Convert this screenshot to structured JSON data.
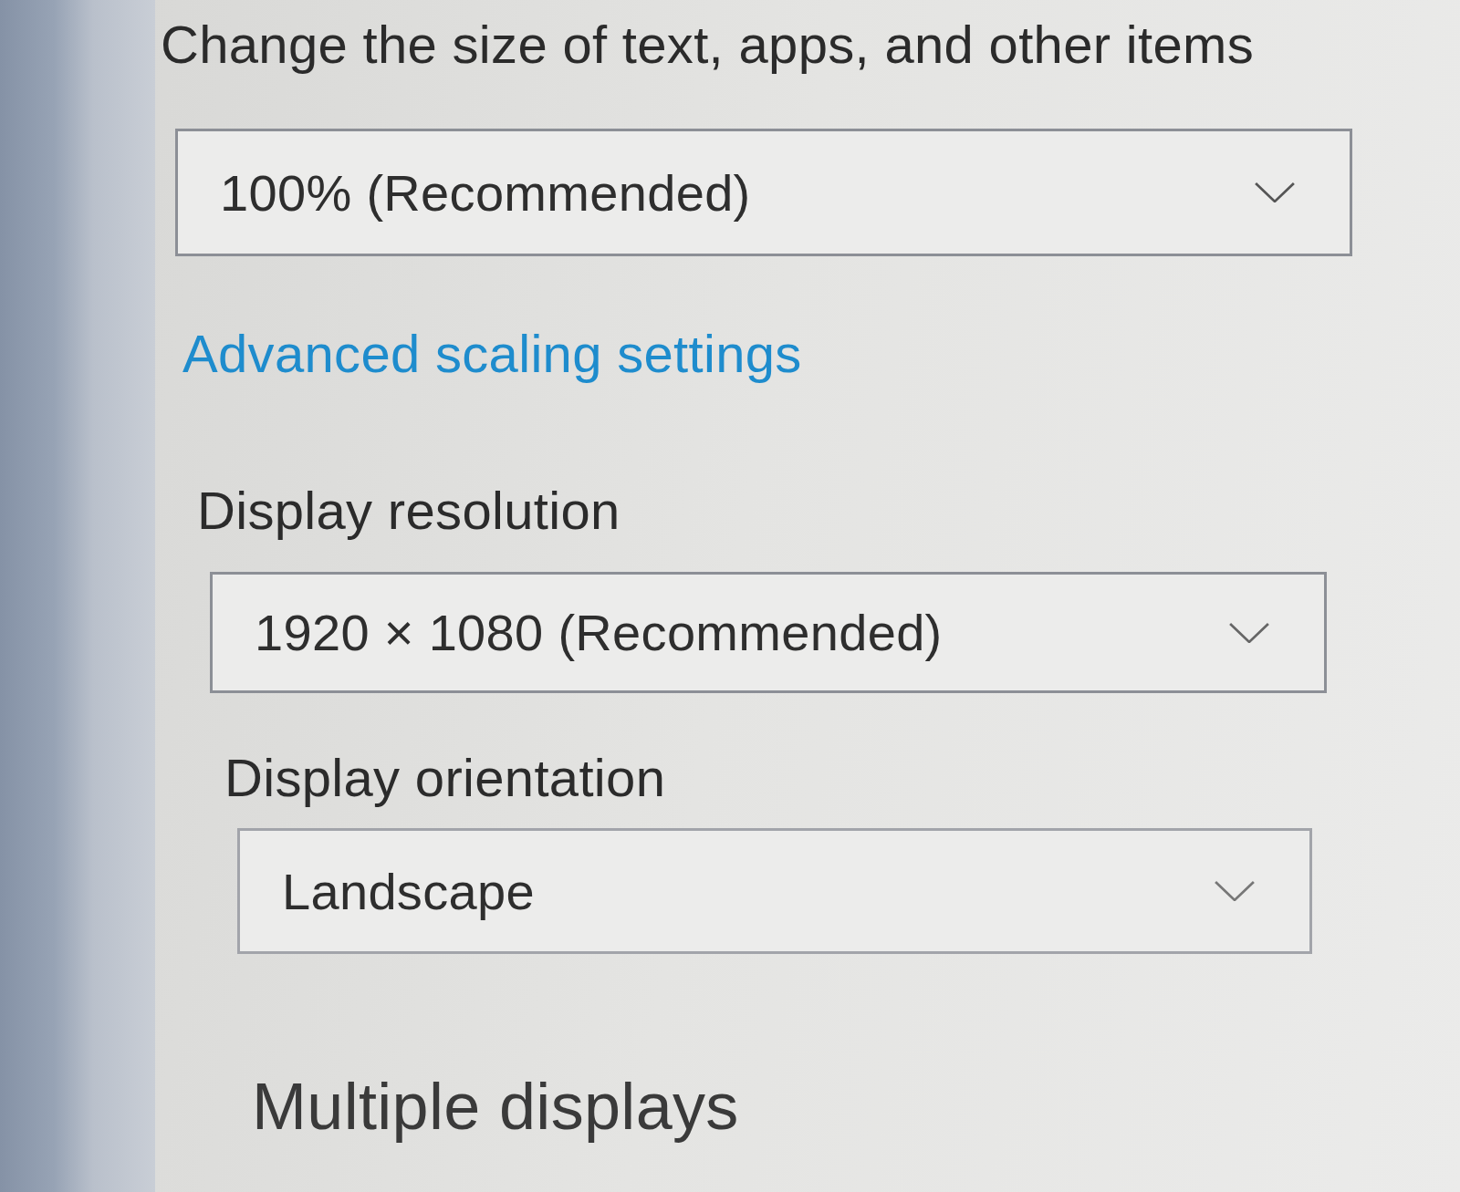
{
  "scale": {
    "label": "Change the size of text, apps, and other items",
    "dropdown": {
      "value": "100% (Recommended)"
    },
    "link": "Advanced scaling settings"
  },
  "resolution": {
    "label": "Display resolution",
    "dropdown": {
      "value": "1920 × 1080 (Recommended)"
    }
  },
  "orientation": {
    "label": "Display orientation",
    "dropdown": {
      "value": "Landscape"
    }
  },
  "section_heading": "Multiple displays"
}
